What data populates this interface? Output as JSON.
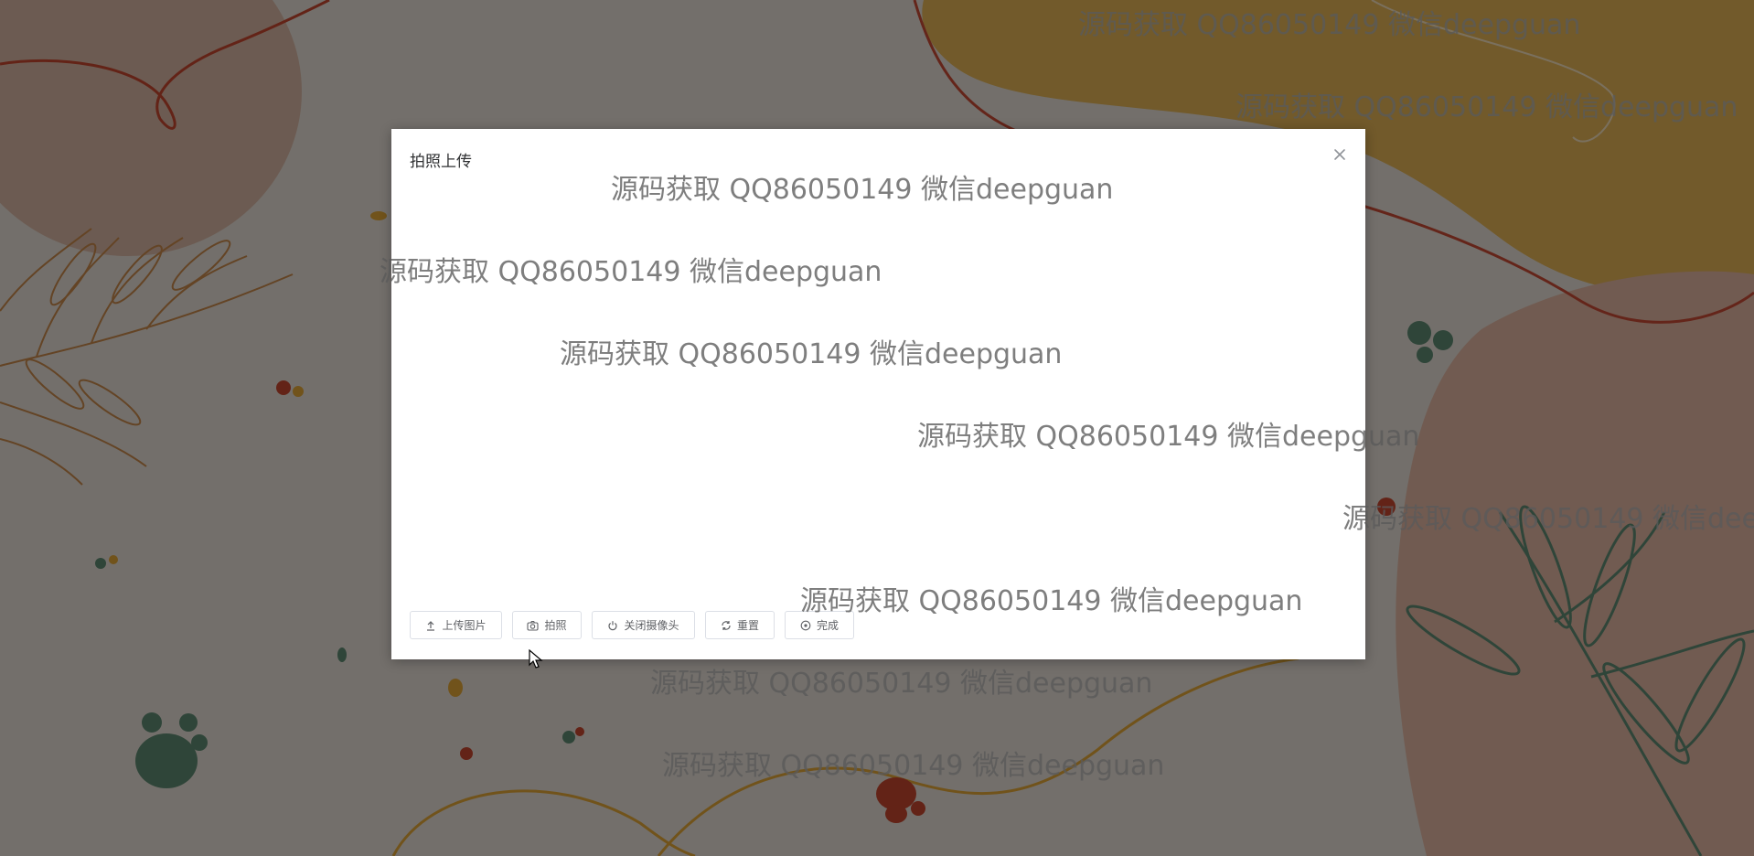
{
  "dialog": {
    "title": "拍照上传",
    "close_icon": "close-icon"
  },
  "toolbar": {
    "upload_label": "上传图片",
    "capture_label": "拍照",
    "close_camera_label": "关闭摄像头",
    "reset_label": "重置",
    "done_label": "完成"
  },
  "watermark": {
    "text": "源码获取 QQ86050149 微信deepguan"
  },
  "colors": {
    "overlay": "#000000",
    "dialog_bg": "#ffffff",
    "button_border": "#dcdfe6",
    "button_text": "#606266"
  }
}
